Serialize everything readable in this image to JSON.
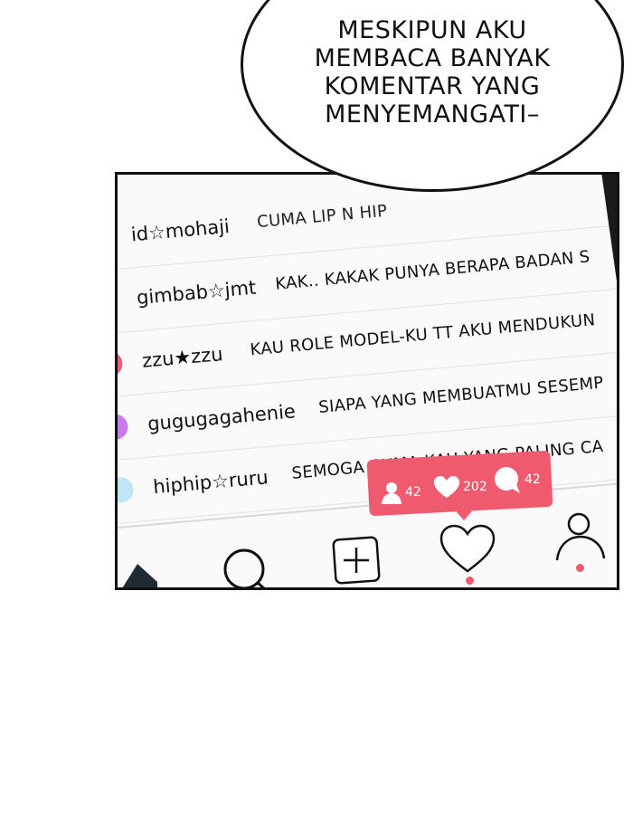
{
  "bubble": {
    "lines": [
      "MESKIPUN AKU",
      "MEMBACA BANYAK",
      "KOMENTAR YANG",
      "MENYEMANGATI–"
    ]
  },
  "comments": [
    {
      "username": "id☆mohaji",
      "text": "CUMA LIP N HIP",
      "avatar_color": "#ffffff"
    },
    {
      "username": "gimbab☆jmt",
      "text": "KAK.. KAKAK PUNYA BERAPA BADAN S",
      "avatar_color": "#ffffff"
    },
    {
      "username": "zzu★zzu",
      "text": "KAU ROLE MODEL-KU TT AKU MENDUKUN",
      "avatar_color": "#ef5a6f"
    },
    {
      "username": "gugugagahenie",
      "text": "SIAPA YANG MEMBUATMU SESEMP",
      "avatar_color": "#c77de6"
    },
    {
      "username": "hiphip☆ruru",
      "text": "SEMOGA CUMA KAU YANG PALING CA",
      "avatar_color": "#bfe6f7"
    }
  ],
  "notification": {
    "followers": "42",
    "likes": "202",
    "comments": "42",
    "color": "#ef5a6f"
  },
  "nav": {
    "icons": [
      "home-icon",
      "search-icon",
      "add-post-icon",
      "heart-icon",
      "profile-icon"
    ]
  }
}
